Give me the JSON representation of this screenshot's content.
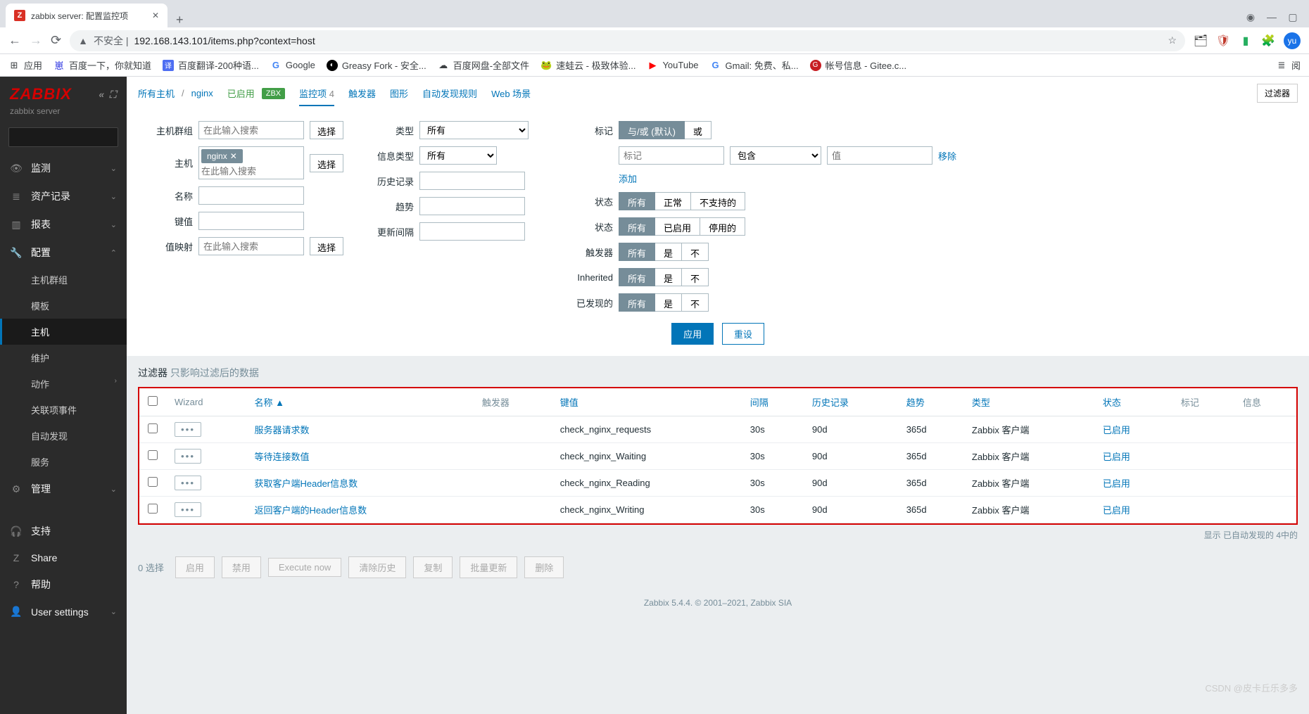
{
  "browser": {
    "tab_title": "zabbix server: 配置监控项",
    "url_prefix": "不安全 | ",
    "url": "192.168.143.101/items.php?context=host",
    "avatar": "yu",
    "bookmarks": {
      "apps": "应用",
      "baidu": "百度一下，你就知道",
      "fanyi": "百度翻译-200种语...",
      "google": "Google",
      "greasy": "Greasy Fork - 安全...",
      "wangpan": "百度网盘-全部文件",
      "suwa": "速蛙云 - 极致体验...",
      "youtube": "YouTube",
      "gmail": "Gmail: 免费、私...",
      "gitee": "帐号信息 - Gitee.c...",
      "reading": "阅"
    }
  },
  "sidebar": {
    "logo": "ZABBIX",
    "subtitle": "zabbix server",
    "menu": {
      "monitoring": "监测",
      "inventory": "资产记录",
      "reports": "报表",
      "configuration": "配置",
      "administration": "管理",
      "support": "支持",
      "share": "Share",
      "help": "帮助",
      "user_settings": "User settings"
    },
    "config_submenu": {
      "hostgroups": "主机群组",
      "templates": "模板",
      "hosts": "主机",
      "maintenance": "维护",
      "actions": "动作",
      "correlation": "关联项事件",
      "discovery": "自动发现",
      "services": "服务"
    }
  },
  "breadcrumb": {
    "all_hosts": "所有主机",
    "host": "nginx",
    "enabled": "已启用",
    "zbx": "ZBX",
    "items": "监控项",
    "items_count": "4",
    "triggers": "触发器",
    "graphs": "图形",
    "discovery": "自动发现规则",
    "web": "Web 场景",
    "filter_toggle": "过滤器"
  },
  "filter": {
    "labels": {
      "hostgroup": "主机群组",
      "host": "主机",
      "name": "名称",
      "key": "键值",
      "valuemap": "值映射",
      "type": "类型",
      "infotype": "信息类型",
      "history": "历史记录",
      "trends": "趋势",
      "interval": "更新间隔",
      "tags": "标记",
      "state": "状态",
      "status": "状态",
      "triggers": "触发器",
      "inherited": "Inherited",
      "discovered": "已发现的"
    },
    "placeholders": {
      "search": "在此输入搜索",
      "tag": "标记",
      "value": "值"
    },
    "host_chip": "nginx",
    "select_btn": "选择",
    "type_all": "所有",
    "tag_andor": "与/或  (默认)",
    "tag_or": "或",
    "tag_op": "包含",
    "tag_remove": "移除",
    "tag_add": "添加",
    "btn_all": "所有",
    "state_normal": "正常",
    "state_notsupported": "不支持的",
    "status_enabled": "已启用",
    "status_disabled": "停用的",
    "btn_yes": "是",
    "btn_no": "不",
    "apply": "应用",
    "reset": "重设",
    "title": "过滤器",
    "title_sub": "只影响过滤后的数据"
  },
  "table": {
    "headers": {
      "wizard": "Wizard",
      "name": "名称",
      "triggers": "触发器",
      "key": "键值",
      "interval": "间隔",
      "history": "历史记录",
      "trends": "趋势",
      "type": "类型",
      "status": "状态",
      "tags": "标记",
      "info": "信息"
    },
    "sort_indicator": "▲",
    "rows": [
      {
        "name": "服务器请求数",
        "key": "check_nginx_requests",
        "interval": "30s",
        "history": "90d",
        "trends": "365d",
        "type": "Zabbix 客户端",
        "status": "已启用"
      },
      {
        "name": "等待连接数值",
        "key": "check_nginx_Waiting",
        "interval": "30s",
        "history": "90d",
        "trends": "365d",
        "type": "Zabbix 客户端",
        "status": "已启用"
      },
      {
        "name": "获取客户端Header信息数",
        "key": "check_nginx_Reading",
        "interval": "30s",
        "history": "90d",
        "trends": "365d",
        "type": "Zabbix 客户端",
        "status": "已启用"
      },
      {
        "name": "返回客户端的Header信息数",
        "key": "check_nginx_Writing",
        "interval": "30s",
        "history": "90d",
        "trends": "365d",
        "type": "Zabbix 客户端",
        "status": "已启用"
      }
    ],
    "footer_info": "显示 已自动发现的 4中的"
  },
  "bulk": {
    "selected": "0 选择",
    "enable": "启用",
    "disable": "禁用",
    "execute": "Execute now",
    "clear_history": "清除历史",
    "copy": "复制",
    "mass_update": "批量更新",
    "delete": "删除"
  },
  "footer": "Zabbix 5.4.4. © 2001–2021, Zabbix SIA",
  "watermark": "CSDN @皮卡丘乐多多"
}
